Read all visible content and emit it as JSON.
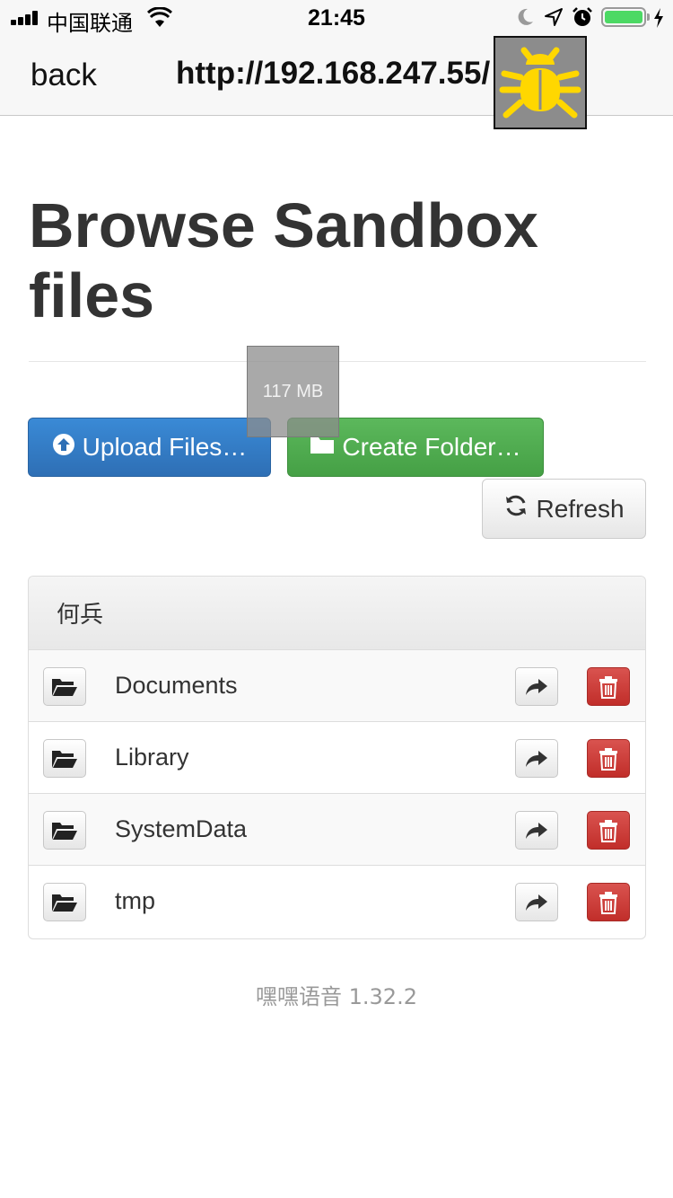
{
  "status_bar": {
    "carrier": "中国联通",
    "time": "21:45",
    "battery_level": 1.0
  },
  "nav": {
    "back_label": "back",
    "url": "http://192.168.247.55/"
  },
  "page": {
    "title": "Browse Sandbox files",
    "size_badge": "117 MB"
  },
  "actions": {
    "upload_label": "Upload Files…",
    "create_folder_label": "Create Folder…",
    "refresh_label": "Refresh"
  },
  "panel": {
    "heading": "何兵",
    "items": [
      {
        "name": "Documents"
      },
      {
        "name": "Library"
      },
      {
        "name": "SystemData"
      },
      {
        "name": "tmp"
      }
    ]
  },
  "footer": {
    "version": "嘿嘿语音 1.32.2"
  },
  "colors": {
    "primary": "#337ab7",
    "success": "#5cb85c",
    "danger": "#d9534f",
    "debug_bug": "#ffd700"
  },
  "icons": {
    "upload": "circle-arrow-up-icon",
    "create": "folder-icon",
    "refresh": "refresh-icon",
    "open": "folder-open-icon",
    "move": "share-arrow-icon",
    "delete": "trash-icon",
    "debug": "bug-icon"
  }
}
